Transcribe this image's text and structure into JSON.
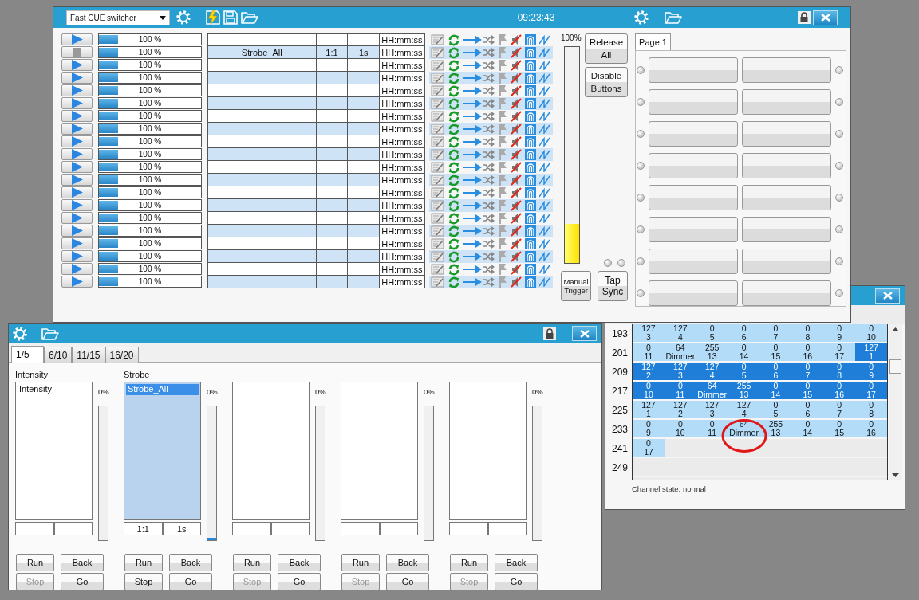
{
  "main_window": {
    "preset": "Fast CUE switcher",
    "clock": "09:23:43",
    "rows": [
      {
        "playing": false,
        "level": 0.19,
        "reading": "100 %",
        "clock": "HH:mm:ss"
      },
      {
        "playing": true,
        "level": 0.19,
        "reading": "100 %",
        "name": "Strobe_All",
        "ratio": "1:1",
        "time": "1s",
        "clock": "HH:mm:ss"
      },
      {
        "playing": false,
        "level": 0.19,
        "reading": "100 %",
        "clock": "HH:mm:ss"
      },
      {
        "playing": false,
        "level": 0.19,
        "reading": "100 %",
        "clock": "HH:mm:ss"
      },
      {
        "playing": false,
        "level": 0.19,
        "reading": "100 %",
        "clock": "HH:mm:ss"
      },
      {
        "playing": false,
        "level": 0.19,
        "reading": "100 %",
        "clock": "HH:mm:ss"
      },
      {
        "playing": false,
        "level": 0.19,
        "reading": "100 %",
        "clock": "HH:mm:ss"
      },
      {
        "playing": false,
        "level": 0.19,
        "reading": "100 %",
        "clock": "HH:mm:ss"
      },
      {
        "playing": false,
        "level": 0.19,
        "reading": "100 %",
        "clock": "HH:mm:ss"
      },
      {
        "playing": false,
        "level": 0.19,
        "reading": "100 %",
        "clock": "HH:mm:ss"
      },
      {
        "playing": false,
        "level": 0.19,
        "reading": "100 %",
        "clock": "HH:mm:ss"
      },
      {
        "playing": false,
        "level": 0.19,
        "reading": "100 %",
        "clock": "HH:mm:ss"
      },
      {
        "playing": false,
        "level": 0.19,
        "reading": "100 %",
        "clock": "HH:mm:ss"
      },
      {
        "playing": false,
        "level": 0.19,
        "reading": "100 %",
        "clock": "HH:mm:ss"
      },
      {
        "playing": false,
        "level": 0.19,
        "reading": "100 %",
        "clock": "HH:mm:ss"
      },
      {
        "playing": false,
        "level": 0.19,
        "reading": "100 %",
        "clock": "HH:mm:ss"
      },
      {
        "playing": false,
        "level": 0.19,
        "reading": "100 %",
        "clock": "HH:mm:ss"
      },
      {
        "playing": false,
        "level": 0.19,
        "reading": "100 %",
        "clock": "HH:mm:ss"
      },
      {
        "playing": false,
        "level": 0.19,
        "reading": "100 %",
        "clock": "HH:mm:ss"
      },
      {
        "playing": false,
        "level": 0.19,
        "reading": "100 %",
        "clock": "HH:mm:ss"
      }
    ],
    "meter": {
      "reading": "100%",
      "level": 0.18
    },
    "side_buttons": [
      "Release All",
      "Disable Buttons"
    ],
    "tap_leds": [
      {
        "on": false
      },
      {
        "on": false
      }
    ],
    "bottom_buttons": [
      "Manual Trigger",
      "Tap Sync"
    ],
    "page_tab": {
      "label": "Page 1",
      "selected": true
    },
    "pads": [
      {
        "led_on": false
      },
      {
        "led_on": false
      },
      {
        "led_on": false
      },
      {
        "led_on": false
      },
      {
        "led_on": false
      },
      {
        "led_on": false
      },
      {
        "led_on": false
      },
      {
        "led_on": false
      },
      {
        "led_on": false
      },
      {
        "led_on": false
      },
      {
        "led_on": false
      },
      {
        "led_on": false
      },
      {
        "led_on": false
      },
      {
        "led_on": false
      },
      {
        "led_on": false
      },
      {
        "led_on": false
      }
    ]
  },
  "cue_window": {
    "tabs": [
      {
        "label": "1/5",
        "selected": true
      },
      {
        "label": "6/10",
        "selected": false
      },
      {
        "label": "11/15",
        "selected": false
      },
      {
        "label": "16/20",
        "selected": false
      }
    ],
    "columns": [
      {
        "title": "Intensity",
        "active": false,
        "items": [
          {
            "label": "Intensity",
            "selected": false
          }
        ],
        "reading": "0%",
        "buttons": [
          {
            "label": "Run",
            "disabled": false
          },
          {
            "label": "Back",
            "disabled": false
          },
          {
            "label": "Stop",
            "disabled": true
          },
          {
            "label": "Go",
            "disabled": false
          }
        ]
      },
      {
        "title": "Strobe",
        "active": true,
        "items": [
          {
            "label": "Strobe_All",
            "selected": true
          }
        ],
        "fields": [
          "1:1",
          "1s"
        ],
        "reading": "0%",
        "level": 0.02,
        "buttons": [
          {
            "label": "Run",
            "disabled": false
          },
          {
            "label": "Back",
            "disabled": false
          },
          {
            "label": "Stop",
            "disabled": false
          },
          {
            "label": "Go",
            "disabled": false
          }
        ]
      },
      {
        "active": false,
        "reading": "0%",
        "buttons": [
          {
            "label": "Run",
            "disabled": false
          },
          {
            "label": "Back",
            "disabled": false
          },
          {
            "label": "Stop",
            "disabled": true
          },
          {
            "label": "Go",
            "disabled": false
          }
        ]
      },
      {
        "active": false,
        "reading": "0%",
        "buttons": [
          {
            "label": "Run",
            "disabled": false
          },
          {
            "label": "Back",
            "disabled": false
          },
          {
            "label": "Stop",
            "disabled": true
          },
          {
            "label": "Go",
            "disabled": false
          }
        ]
      },
      {
        "active": false,
        "reading": "0%",
        "buttons": [
          {
            "label": "Run",
            "disabled": false
          },
          {
            "label": "Back",
            "disabled": false
          },
          {
            "label": "Stop",
            "disabled": true
          },
          {
            "label": "Go",
            "disabled": false
          }
        ]
      }
    ]
  },
  "channels_window": {
    "rows": [
      {
        "address": "193",
        "cells": [
          {
            "value": "127",
            "label": "3",
            "selected": false,
            "circled": false
          },
          {
            "value": "127",
            "label": "4",
            "selected": false,
            "circled": false
          },
          {
            "value": "0",
            "label": "5",
            "selected": false,
            "circled": false
          },
          {
            "value": "0",
            "label": "6",
            "selected": false,
            "circled": false
          },
          {
            "value": "0",
            "label": "7",
            "selected": false,
            "circled": false
          },
          {
            "value": "0",
            "label": "8",
            "selected": false,
            "circled": false
          },
          {
            "value": "0",
            "label": "9",
            "selected": false,
            "circled": false
          },
          {
            "value": "0",
            "label": "10",
            "selected": false,
            "circled": false
          }
        ]
      },
      {
        "address": "201",
        "cells": [
          {
            "value": "0",
            "label": "11",
            "selected": false,
            "circled": false
          },
          {
            "value": "64",
            "label": "Dimmer",
            "selected": false,
            "circled": false
          },
          {
            "value": "255",
            "label": "13",
            "selected": false,
            "circled": false
          },
          {
            "value": "0",
            "label": "14",
            "selected": false,
            "circled": false
          },
          {
            "value": "0",
            "label": "15",
            "selected": false,
            "circled": false
          },
          {
            "value": "0",
            "label": "16",
            "selected": false,
            "circled": false
          },
          {
            "value": "0",
            "label": "17",
            "selected": false,
            "circled": false
          },
          {
            "value": "127",
            "label": "1",
            "selected": true,
            "circled": false
          }
        ]
      },
      {
        "address": "209",
        "cells": [
          {
            "value": "127",
            "label": "2",
            "selected": true,
            "circled": false
          },
          {
            "value": "127",
            "label": "3",
            "selected": true,
            "circled": false
          },
          {
            "value": "127",
            "label": "4",
            "selected": true,
            "circled": false
          },
          {
            "value": "0",
            "label": "5",
            "selected": true,
            "circled": false
          },
          {
            "value": "0",
            "label": "6",
            "selected": true,
            "circled": false
          },
          {
            "value": "0",
            "label": "7",
            "selected": true,
            "circled": false
          },
          {
            "value": "0",
            "label": "8",
            "selected": true,
            "circled": false
          },
          {
            "value": "0",
            "label": "9",
            "selected": true,
            "circled": false
          }
        ]
      },
      {
        "address": "217",
        "cells": [
          {
            "value": "0",
            "label": "10",
            "selected": true,
            "circled": false
          },
          {
            "value": "0",
            "label": "11",
            "selected": true,
            "circled": false
          },
          {
            "value": "64",
            "label": "Dimmer",
            "selected": true,
            "circled": false
          },
          {
            "value": "255",
            "label": "13",
            "selected": true,
            "circled": false
          },
          {
            "value": "0",
            "label": "14",
            "selected": true,
            "circled": false
          },
          {
            "value": "0",
            "label": "15",
            "selected": true,
            "circled": false
          },
          {
            "value": "0",
            "label": "16",
            "selected": true,
            "circled": false
          },
          {
            "value": "0",
            "label": "17",
            "selected": true,
            "circled": false
          }
        ]
      },
      {
        "address": "225",
        "cells": [
          {
            "value": "127",
            "label": "1",
            "selected": false,
            "circled": false
          },
          {
            "value": "127",
            "label": "2",
            "selected": false,
            "circled": false
          },
          {
            "value": "127",
            "label": "3",
            "selected": false,
            "circled": false
          },
          {
            "value": "127",
            "label": "4",
            "selected": false,
            "circled": false
          },
          {
            "value": "0",
            "label": "5",
            "selected": false,
            "circled": false
          },
          {
            "value": "0",
            "label": "6",
            "selected": false,
            "circled": false
          },
          {
            "value": "0",
            "label": "7",
            "selected": false,
            "circled": false
          },
          {
            "value": "0",
            "label": "8",
            "selected": false,
            "circled": false
          }
        ]
      },
      {
        "address": "233",
        "cells": [
          {
            "value": "0",
            "label": "9",
            "selected": false,
            "circled": false
          },
          {
            "value": "0",
            "label": "10",
            "selected": false,
            "circled": false
          },
          {
            "value": "0",
            "label": "11",
            "selected": false,
            "circled": false
          },
          {
            "value": "64",
            "label": "Dimmer",
            "selected": false,
            "circled": true
          },
          {
            "value": "255",
            "label": "13",
            "selected": false,
            "circled": false
          },
          {
            "value": "0",
            "label": "14",
            "selected": false,
            "circled": false
          },
          {
            "value": "0",
            "label": "15",
            "selected": false,
            "circled": false
          },
          {
            "value": "0",
            "label": "16",
            "selected": false,
            "circled": false
          }
        ]
      },
      {
        "address": "241",
        "cells": [
          {
            "value": "0",
            "label": "17",
            "selected": false,
            "circled": false
          }
        ]
      },
      {
        "address": "249"
      }
    ],
    "status": "Channel state: normal"
  }
}
